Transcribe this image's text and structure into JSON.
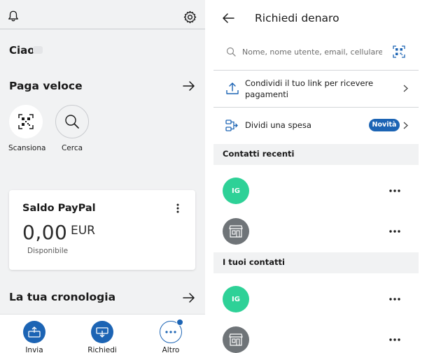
{
  "left": {
    "greeting": "Ciao",
    "quick_pay": {
      "title": "Paga veloce",
      "items": [
        {
          "label": "Scansiona",
          "icon": "qr-scan-icon"
        },
        {
          "label": "Cerca",
          "icon": "search-icon"
        }
      ]
    },
    "balance": {
      "title": "Saldo PayPal",
      "amount": "0,00",
      "currency": "EUR",
      "status": "Disponibile"
    },
    "history": {
      "title": "La tua cronologia"
    },
    "bottom_nav": [
      {
        "label": "Invia",
        "icon": "send-money-icon"
      },
      {
        "label": "Richiedi",
        "icon": "request-money-icon"
      },
      {
        "label": "Altro",
        "icon": "more-icon"
      }
    ]
  },
  "right": {
    "header": {
      "title": "Richiedi denaro"
    },
    "search": {
      "placeholder": "Nome, nome utente, email, cellulare"
    },
    "actions": [
      {
        "label": "Condividi il tuo link per ricevere pagamenti",
        "icon": "share-icon"
      },
      {
        "label": "Dividi una spesa",
        "icon": "split-icon",
        "badge": "Novità"
      }
    ],
    "recent_contacts": {
      "title": "Contatti recenti",
      "items": [
        {
          "initials": "IG",
          "type": "initials"
        },
        {
          "initials": "",
          "type": "shop"
        }
      ]
    },
    "your_contacts": {
      "title": "I tuoi contatti",
      "items": [
        {
          "initials": "IG",
          "type": "initials"
        },
        {
          "initials": "",
          "type": "shop"
        }
      ]
    }
  },
  "colors": {
    "accent_blue": "#1c64b4",
    "avatar_green": "#2ed197",
    "avatar_gray": "#6f7478",
    "panel_gray": "#f1f2f3"
  }
}
